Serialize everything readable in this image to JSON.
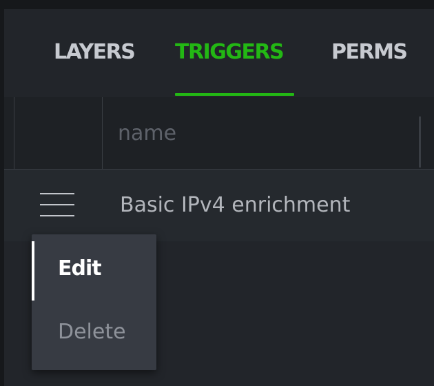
{
  "tabs": [
    {
      "label": "LAYERS",
      "active": false
    },
    {
      "label": "TRIGGERS",
      "active": true
    },
    {
      "label": "PERMS",
      "active": false
    }
  ],
  "filter": {
    "placeholder": "name",
    "value": ""
  },
  "rows": [
    {
      "label": "Basic IPv4 enrichment",
      "menu_icon": "hamburger-icon"
    }
  ],
  "context_menu": {
    "items": [
      {
        "label": "Edit",
        "state": "active"
      },
      {
        "label": "Delete",
        "state": "disabled"
      }
    ]
  },
  "colors": {
    "accent": "#23b814",
    "background": "#22252a",
    "menu": "#373b43"
  }
}
